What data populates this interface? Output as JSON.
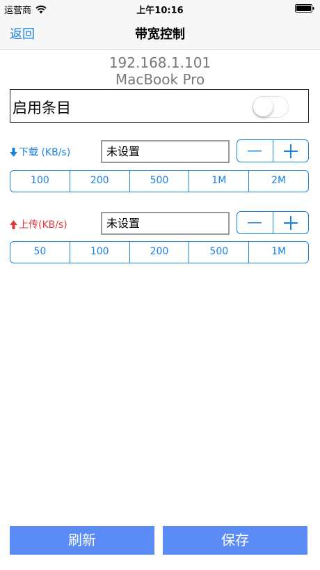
{
  "status_bar": {
    "carrier": "运营商",
    "time": "上午10:16"
  },
  "nav": {
    "back_label": "返回",
    "title": "带宽控制"
  },
  "device": {
    "ip": "192.168.1.101",
    "name": "MacBook Pro"
  },
  "enable": {
    "label": "启用条目",
    "on": false
  },
  "download": {
    "label": "下载 (KB/s)",
    "icon": "arrow-down-icon",
    "value": "未设置",
    "presets": [
      "100",
      "200",
      "500",
      "1M",
      "2M"
    ]
  },
  "upload": {
    "label": "上传(KB/s)",
    "icon": "arrow-up-icon",
    "value": "未设置",
    "presets": [
      "50",
      "100",
      "200",
      "500",
      "1M"
    ]
  },
  "buttons": {
    "refresh": "刷新",
    "save": "保存"
  },
  "colors": {
    "accent": "#1a82e2",
    "upload": "#e23a3a",
    "button_bg": "#5b8cf5"
  }
}
